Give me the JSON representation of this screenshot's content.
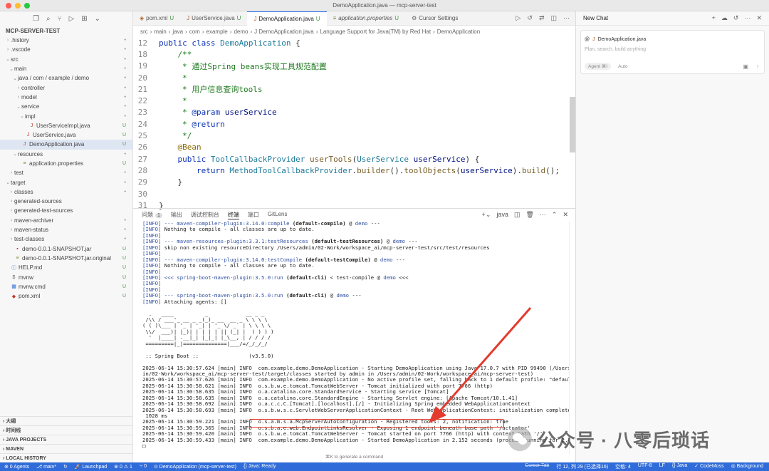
{
  "window": {
    "title": "DemoApplication.java — mcp-server-test"
  },
  "explorer": {
    "root": "MCP-SERVER-TEST",
    "items": [
      {
        "indent": 1,
        "chev": "›",
        "icon": "",
        "label": ".history",
        "status": "•"
      },
      {
        "indent": 1,
        "chev": "›",
        "icon": "",
        "label": ".vscode",
        "status": "•"
      },
      {
        "indent": 1,
        "chev": "⌄",
        "icon": "",
        "label": "src",
        "status": "•"
      },
      {
        "indent": 2,
        "chev": "⌄",
        "icon": "",
        "label": "main",
        "status": "•"
      },
      {
        "indent": 3,
        "chev": "⌄",
        "icon": "",
        "label": "java / com / example / demo",
        "status": "•"
      },
      {
        "indent": 4,
        "chev": "›",
        "icon": "",
        "label": "controller",
        "status": "•"
      },
      {
        "indent": 4,
        "chev": "›",
        "icon": "",
        "label": "model",
        "status": "•"
      },
      {
        "indent": 4,
        "chev": "⌄",
        "icon": "",
        "label": "service",
        "status": "•"
      },
      {
        "indent": 5,
        "chev": "⌄",
        "icon": "",
        "label": "impl",
        "status": "•"
      },
      {
        "indent": 6,
        "chev": "",
        "icon": "J",
        "label": "UserServiceImpl.java",
        "status": "U"
      },
      {
        "indent": 5,
        "chev": "",
        "icon": "J",
        "label": "UserService.java",
        "status": "U"
      },
      {
        "indent": 4,
        "chev": "",
        "icon": "J",
        "label": "DemoApplication.java",
        "status": "U",
        "selected": true
      },
      {
        "indent": 3,
        "chev": "⌄",
        "icon": "",
        "label": "resources",
        "status": "•"
      },
      {
        "indent": 4,
        "chev": "",
        "icon": "≡",
        "label": "application.properties",
        "status": "U"
      },
      {
        "indent": 2,
        "chev": "›",
        "icon": "",
        "label": "test",
        "status": "•"
      },
      {
        "indent": 1,
        "chev": "⌄",
        "icon": "",
        "label": "target",
        "status": "•"
      },
      {
        "indent": 2,
        "chev": "›",
        "icon": "",
        "label": "classes",
        "status": "•"
      },
      {
        "indent": 2,
        "chev": "›",
        "icon": "",
        "label": "generated-sources",
        "status": ""
      },
      {
        "indent": 2,
        "chev": "›",
        "icon": "",
        "label": "generated-test-sources",
        "status": ""
      },
      {
        "indent": 2,
        "chev": "›",
        "icon": "",
        "label": "maven-archiver",
        "status": "•"
      },
      {
        "indent": 2,
        "chev": "›",
        "icon": "",
        "label": "maven-status",
        "status": "•"
      },
      {
        "indent": 2,
        "chev": "›",
        "icon": "",
        "label": "test-classes",
        "status": "•"
      },
      {
        "indent": 2,
        "chev": "",
        "icon": "▪",
        "label": "demo-0.0.1-SNAPSHOT.jar",
        "status": "U"
      },
      {
        "indent": 2,
        "chev": "",
        "icon": "≡",
        "label": "demo-0.0.1-SNAPSHOT.jar.original",
        "status": "U"
      },
      {
        "indent": 1,
        "chev": "",
        "icon": "ⓘ",
        "label": "HELP.md",
        "status": "U"
      },
      {
        "indent": 1,
        "chev": "",
        "icon": "$",
        "label": "mvnw",
        "status": "U"
      },
      {
        "indent": 1,
        "chev": "",
        "icon": "▦",
        "label": "mvnw.cmd",
        "status": "U"
      },
      {
        "indent": 1,
        "chev": "",
        "icon": "◆",
        "label": "pom.xml",
        "status": "U"
      }
    ],
    "bottom_sections": [
      "大纲",
      "时间线",
      "JAVA PROJECTS",
      "MAVEN",
      "LOCAL HISTORY"
    ]
  },
  "tabs": [
    {
      "icon": "◈",
      "label": "pom.xml",
      "status": "U",
      "active": false
    },
    {
      "icon": "J",
      "label": "UserService.java",
      "status": "U",
      "active": false
    },
    {
      "icon": "J",
      "label": "DemoApplication.java",
      "status": "U",
      "active": true
    },
    {
      "icon": "≡",
      "label": "application.properties",
      "status": "U",
      "active": false
    },
    {
      "icon": "⚙",
      "label": "Cursor Settings",
      "status": "",
      "active": false
    }
  ],
  "breadcrumb": [
    "src",
    "main",
    "java",
    "com",
    "example",
    "demo",
    "J DemoApplication.java",
    "Language Support for Java(TM) by Red Hat",
    "DemoApplication"
  ],
  "editor": {
    "lines": [
      {
        "n": "12",
        "html": "<span class='kw'>public class</span> <span class='ty'>DemoApplication</span> {"
      },
      {
        "n": "18",
        "html": "    <span class='cm'>/**</span>"
      },
      {
        "n": "19",
        "html": "    <span class='cm'> * 通过Spring beans实现工具规范配置</span>"
      },
      {
        "n": "20",
        "html": "    <span class='cm'> *</span>"
      },
      {
        "n": "21",
        "html": "    <span class='cm'> * 用户信息查询tools</span>"
      },
      {
        "n": "22",
        "html": "    <span class='cm'> *</span>"
      },
      {
        "n": "23",
        "html": "    <span class='cm'> * <span class='kw'>@param</span> <span class='pm'>userService</span></span>"
      },
      {
        "n": "24",
        "html": "    <span class='cm'> * <span class='kw'>@return</span></span>"
      },
      {
        "n": "25",
        "html": "    <span class='cm'> */</span>"
      },
      {
        "n": "26",
        "html": "    <span class='an'>@Bean</span>"
      },
      {
        "n": "27",
        "html": "    <span class='kw'>public</span> <span class='ty'>ToolCallbackProvider</span> <span class='fn'>userTools</span>(<span class='ty'>UserService</span> <span class='pm'>userService</span>) {"
      },
      {
        "n": "28",
        "html": "        <span class='kw'>return</span> <span class='ty'>MethodToolCallbackProvider</span>.<span class='fn'>builder</span>().<span class='fn'>toolObjects</span>(<span class='pm'>userService</span>).<span class='fn'>build</span>();"
      },
      {
        "n": "29",
        "html": "    }"
      },
      {
        "n": "30",
        "html": ""
      },
      {
        "n": "31",
        "html": "}"
      }
    ]
  },
  "panel": {
    "tabs": [
      "问题",
      "输出",
      "调试控制台",
      "终端",
      "端口",
      "GitLens"
    ],
    "problems_count": "1",
    "active_tab": "终端",
    "terminal_name": "java"
  },
  "terminal": {
    "lines": [
      "<span class='blue'>[INFO]</span> <span class='blue'>--- maven-compiler-plugin:3.14.0:compile</span> <b>(default-compile)</b> @ <span class='blue'>demo</span> ---",
      "<span class='blue'>[INFO]</span> Nothing to compile - all classes are up to date.",
      "<span class='blue'>[INFO]</span>",
      "<span class='blue'>[INFO]</span> <span class='blue'>--- maven-resources-plugin:3.3.1:testResources</span> <b>(default-testResources)</b> @ <span class='blue'>demo</span> ---",
      "<span class='blue'>[INFO]</span> skip non existing resourceDirectory /Users/admin/02-Work/workspace_ai/mcp-server-test/src/test/resources",
      "<span class='blue'>[INFO]</span>",
      "<span class='blue'>[INFO]</span> <span class='blue'>--- maven-compiler-plugin:3.14.0:testCompile</span> <b>(default-testCompile)</b> @ <span class='blue'>demo</span> ---",
      "<span class='blue'>[INFO]</span> Nothing to compile - all classes are up to date.",
      "<span class='blue'>[INFO]</span>",
      "<span class='blue'>[INFO]</span> <span class='blue'>&lt;&lt;&lt; spring-boot-maven-plugin:3.5.0:run</span> <b>(default-cli)</b> &lt; test-compile @ <span class='blue'>demo</span> &lt;&lt;&lt;",
      "<span class='blue'>[INFO]</span>",
      "<span class='blue'>[INFO]</span>",
      "<span class='blue'>[INFO]</span> <span class='blue'>--- spring-boot-maven-plugin:3.5.0:run</span> <b>(default-cli)</b> @ <span class='blue'>demo</span> ---",
      "<span class='blue'>[INFO]</span> Attaching agents: []",
      "",
      "  .   ____          _            __ _ _",
      " /\\\\ / ___'_ __ _ _(_)_ __  __ _ \\ \\ \\ \\",
      "( ( )\\___ | '_ | '_| | '_ \\/ _` | \\ \\ \\ \\",
      " \\\\/  ___)| |_)| | | | | || (_| |  ) ) ) )",
      "  '  |____| .__|_| |_|_| |_\\__, | / / / /",
      " =========|_|==============|___/=/_/_/_/",
      "",
      " :: Spring Boot ::                (v3.5.0)",
      "",
      "2025-06-14 15:30:57.624 [main] INFO  com.example.demo.DemoApplication - Starting DemoApplication using Java 17.0.7 with PID 99490 (/Users/adm",
      "in/02-Work/workspace_ai/mcp-server-test/target/classes started by admin in /Users/admin/02-Work/workspace_ai/mcp-server-test)",
      "2025-06-14 15:30:57.626 [main] INFO  com.example.demo.DemoApplication - No active profile set, falling back to 1 default profile: \"default\"",
      "2025-06-14 15:30:58.621 [main] INFO  o.s.b.w.e.tomcat.TomcatWebServer - Tomcat initialized with port 7766 (http)",
      "2025-06-14 15:30:58.635 [main] INFO  o.a.catalina.core.StandardService - Starting service [Tomcat]",
      "2025-06-14 15:30:58.635 [main] INFO  o.a.catalina.core.StandardEngine - Starting Servlet engine: [Apache Tomcat/10.1.41]",
      "2025-06-14 15:30:58.692 [main] INFO  o.a.c.c.C.[Tomcat].[localhost].[/] - Initializing Spring embedded WebApplicationContext",
      "2025-06-14 15:30:58.693 [main] INFO  o.s.b.w.s.c.ServletWebServerApplicationContext - Root WebApplicationContext: initialization completed in",
      " 1028 ms",
      "2025-06-14 15:30:59.221 [main] INFO  o.s.a.m.s.a.McpServerAutoConfiguration - Registered tools: 2, notification: true",
      "2025-06-14 15:30:59.365 [main] INFO  o.s.b.a.e.web.EndpointLinksResolver - Exposing 1 endpoint beneath base path '/actuator'",
      "2025-06-14 15:30:59.420 [main] INFO  o.s.b.w.e.tomcat.TomcatWebServer - Tomcat started on port 7766 (http) with context path '/'",
      "2025-06-14 15:30:59.433 [main] INFO  com.example.demo.DemoApplication - Started DemoApplication in 2.152 seconds (process running for 2.426)",
      "□"
    ]
  },
  "hint": "⌘K to generate a command",
  "chat": {
    "title": "New Chat",
    "context_file": "DemoApplication.java",
    "placeholder": "Plan, search, build anything",
    "agent_label": "Agent ⌘I",
    "auto_label": "Auto"
  },
  "watermark": "公众号 · 八零后琐话",
  "statusbar": {
    "left": [
      "⊗ 0 Agents",
      "⎇ main*",
      "↻",
      "🚀 Launchpad",
      "⊗ 0 ⚠ 1",
      "⑂ 0",
      "⊙ DemoApplication (mcp-server-test)",
      "{} Java: Ready"
    ],
    "right": [
      "Cursor Tab",
      "行 12, 列 29 (已选择16)",
      "空格: 4",
      "UTF-8",
      "LF",
      "{} Java",
      "✓ CodeMoss",
      "◎ Background"
    ]
  },
  "colors": {
    "accent": "#3574f0",
    "statusbar": "#2f6bd9",
    "highlight": "#e33b2e"
  }
}
